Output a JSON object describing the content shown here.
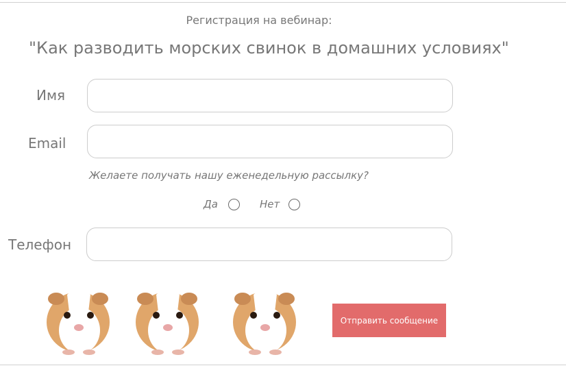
{
  "header": {
    "subtitle": "Регистрация на вебинар:",
    "title": "\"Как разводить морских свинок в домашних условиях\""
  },
  "form": {
    "name_label": "Имя",
    "name_value": "",
    "email_label": "Email",
    "email_value": "",
    "newsletter_question": "Желаете получать нашу еженедельную рассылку?",
    "radio_yes_label": "Да",
    "radio_no_label": "Нет",
    "phone_label": "Телефон",
    "phone_value": "",
    "submit_label": "Отправить сообщение"
  },
  "images": [
    "guinea-pig-icon",
    "guinea-pig-icon",
    "guinea-pig-icon"
  ],
  "colors": {
    "text": "#777777",
    "button": "#e26b6b",
    "button_text": "#ffffff",
    "border": "#cccccc"
  }
}
